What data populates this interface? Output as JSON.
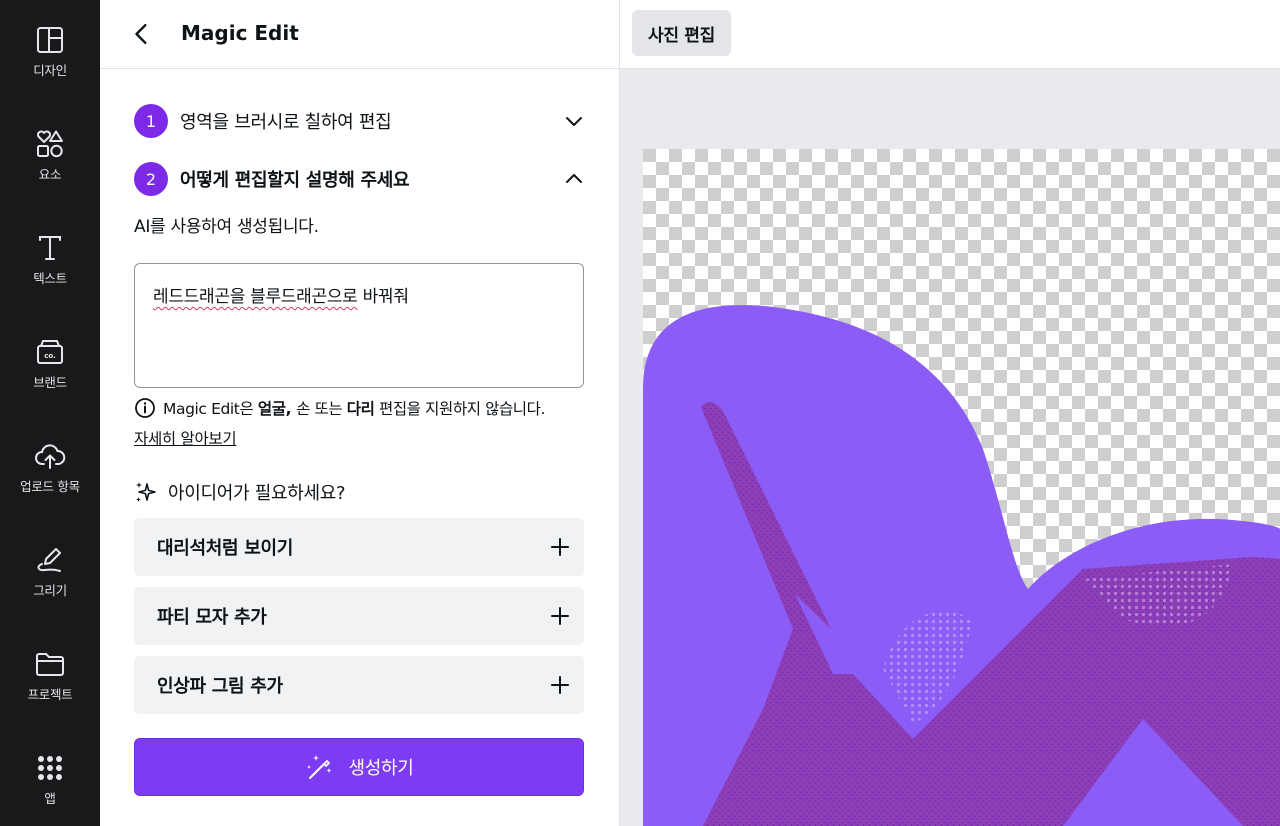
{
  "rail": {
    "items": [
      {
        "label": "디자인",
        "icon": "layout-icon"
      },
      {
        "label": "요소",
        "icon": "elements-icon"
      },
      {
        "label": "텍스트",
        "icon": "text-icon"
      },
      {
        "label": "브랜드",
        "icon": "brand-icon"
      },
      {
        "label": "업로드 항목",
        "icon": "upload-cloud-icon"
      },
      {
        "label": "그리기",
        "icon": "draw-icon"
      },
      {
        "label": "프로젝트",
        "icon": "folder-icon"
      },
      {
        "label": "앱",
        "icon": "apps-grid-icon"
      }
    ]
  },
  "panel": {
    "title": "Magic Edit",
    "steps": [
      {
        "number": "1",
        "label": "영역을 브러시로 칠하여 편집",
        "state": "collapsed"
      },
      {
        "number": "2",
        "label": "어떻게 편집할지 설명해 주세요",
        "state": "expanded"
      }
    ],
    "ai_note": "AI를 사용하여 생성됩니다.",
    "prompt": {
      "underlined_part": "레드드래곤을 블루드래곤으로",
      "rest": " 바꿔줘"
    },
    "info": {
      "prefix": "Magic Edit은 ",
      "bold1": "얼굴",
      "sep1": ", ",
      "plain_mid": "손 또는 ",
      "bold2": "다리",
      "suffix": " 편집을 지원하지 않습니다."
    },
    "learn_more": "자세히 알아보기",
    "ideas_label": "아이디어가 필요하세요?",
    "suggestions": [
      "대리석처럼 보이기",
      "파티 모자 추가",
      "인상파 그림 추가"
    ],
    "generate_label": "생성하기"
  },
  "topbar": {
    "tab_label": "사진 편집"
  },
  "colors": {
    "accent": "#7d2ae8",
    "button": "#7d3cf3",
    "rail_bg": "#18191b",
    "brush_overlay": "#8b5cf6",
    "dragon_purple": "#8e3fb7"
  }
}
